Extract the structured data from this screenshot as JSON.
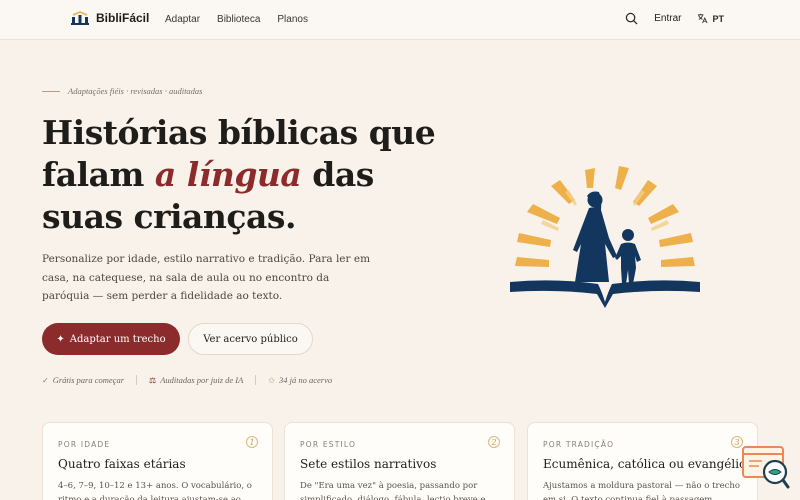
{
  "header": {
    "brand": "BibliFácil",
    "nav": [
      "Adaptar",
      "Biblioteca",
      "Planos"
    ],
    "login": "Entrar",
    "lang": "PT",
    "icons": [
      "logo-icon",
      "search-icon",
      "translate-icon"
    ]
  },
  "hero": {
    "eyebrow": "Adaptações fiéis · revisadas · auditadas",
    "headline_part1": "Histórias bíblicas que falam ",
    "headline_accent": "a língua",
    "headline_part2": " das suas crianças.",
    "lede": "Personalize por idade, estilo narrativo e tradição. Para ler em casa, na catequese, na sala de aula ou no encontro da paróquia — sem perder a fidelidade ao texto.",
    "primary_cta": "Adaptar um trecho",
    "secondary_cta": "Ver acervo público",
    "meta": [
      "Grátis para começar",
      "Auditadas por juiz de IA",
      "34 já no acervo"
    ]
  },
  "colors": {
    "accent": "#8c2b2b",
    "navy": "#12365e",
    "sun": "#eeb04a",
    "bg": "#f8f2ea"
  },
  "cards": [
    {
      "kicker": "POR IDADE",
      "num": "1",
      "title": "Quatro faixas etárias",
      "desc": "4–6, 7–9, 10–12 e 13+ anos. O vocabulário, o ritmo e a duração da leitura ajustam-se ao"
    },
    {
      "kicker": "POR ESTILO",
      "num": "2",
      "title": "Sete estilos narrativos",
      "desc": "De \"Era uma vez\" à poesia, passando por simplificado, diálogo, fábula, lectio breve e"
    },
    {
      "kicker": "POR TRADIÇÃO",
      "num": "3",
      "title": "Ecumênica, católica ou evangélica",
      "desc": "Ajustamos a moldura pastoral — não o trecho em si. O texto continua fiel à passagem"
    }
  ]
}
